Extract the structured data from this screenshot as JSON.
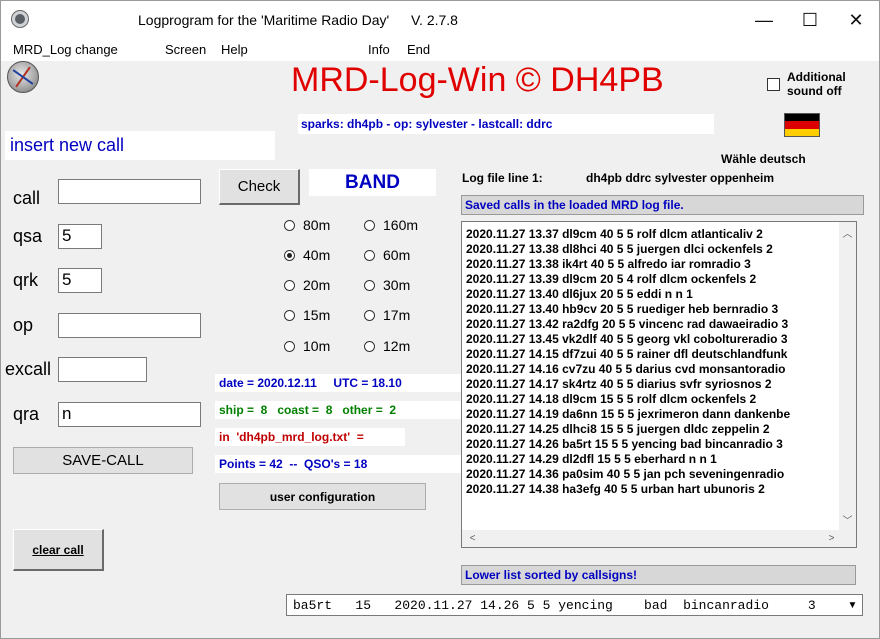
{
  "window": {
    "title": "Logprogram for the 'Maritime Radio Day'",
    "version": "V. 2.7.8",
    "minimize": "—",
    "maximize": "☐",
    "close": "✕"
  },
  "menu": [
    "MRD_Log change",
    "Screen",
    "Help",
    "Info",
    "End"
  ],
  "header": {
    "app_title": "MRD-Log-Win © DH4PB",
    "sound_label_1": "Additional",
    "sound_label_2": "sound off",
    "status": "sparks: dh4pb - op: sylvester - lastcall: ddrc",
    "language": "Wähle deutsch",
    "flag_colors": [
      "#000000",
      "#dd0000",
      "#ffce00"
    ]
  },
  "form": {
    "insert_label": "insert new call",
    "labels": {
      "call": "call",
      "qsa": "qsa",
      "qrk": "qrk",
      "op": "op",
      "excall": "excall",
      "qra": "qra"
    },
    "values": {
      "call": "",
      "qsa": "5",
      "qrk": "5",
      "op": "",
      "excall": "",
      "qra": "n"
    },
    "save_button": "SAVE-CALL",
    "clear_button": "clear call"
  },
  "check_button": "Check",
  "band": {
    "title": "BAND",
    "options": [
      "80m",
      "160m",
      "40m",
      "60m",
      "20m",
      "30m",
      "15m",
      "17m",
      "10m",
      "12m"
    ],
    "selected": "40m"
  },
  "info": {
    "date_line": "date = 2020.12.11     UTC = 18.10",
    "ship_line": "ship =  8   coast =  8   other =  2",
    "file_line": "in  'dh4pb_mrd_log.txt'  =",
    "points_line": "Points = 42  --  QSO's = 18",
    "date_color": "#0000c0",
    "ship_color": "#008000",
    "file_color": "#c00000",
    "points_color": "#0000c0"
  },
  "user_config_button": "user configuration",
  "log": {
    "file_label": "Log file line 1:",
    "file_value": "dh4pb ddrc sylvester oppenheim",
    "saved_caption": "Saved calls in the loaded MRD log file.",
    "entries": [
      "2020.11.27 13.37 dl9cm 40 5 5 rolf dlcm atlanticaliv 2",
      "2020.11.27 13.38 dl8hci 40 5 5 juergen dlci ockenfels 2",
      "2020.11.27 13.38 ik4rt 40 5 5 alfredo iar romradio 3",
      "2020.11.27 13.39 dl9cm 20 5 4 rolf dlcm ockenfels 2",
      "2020.11.27 13.40 dl6jux 20 5 5 eddi n n 1",
      "2020.11.27 13.40 hb9cv 20 5 5 ruediger heb bernradio 3",
      "2020.11.27 13.42 ra2dfg 20 5 5 vincenc rad dawaeiradio 3",
      "2020.11.27 13.45 vk2dlf 40 5 5 georg vkl cobolturerad​io 3",
      "2020.11.27 14.15 df7zui 40 5 5 rainer dfl deutschlandfunk",
      "2020.11.27 14.16 cv7zu 40 5 5 darius cvd monsantoradio",
      "2020.11.27 14.17 sk4rtz 40 5 5 diarius svfr syriosnos 2",
      "2020.11.27 14.18 dl9cm 15 5 5 rolf dlcm ockenfels 2",
      "2020.11.27 14.19 da6nn 15 5 5 jexrimeron dann dankenbe",
      "2020.11.27 14.25 dlhci8 15 5 5 juergen dldc zeppelin 2",
      "2020.11.27 14.26 ba5rt 15 5 5 yencing bad bincanradio 3",
      "2020.11.27 14.29 dl2dfl 15 5 5 eberhard n n 1",
      "2020.11.27 14.36 pa0sim 40 5 5 jan pch seveningenradio",
      "2020.11.27 14.38 ha3efg 40 5 5 urban hart ubunoris 2"
    ],
    "sorted_caption": "Lower list sorted by callsigns!",
    "combo_value": "ba5rt   15   2020.11.27 14.26 5 5 yencing    bad  bincanradio     3"
  }
}
